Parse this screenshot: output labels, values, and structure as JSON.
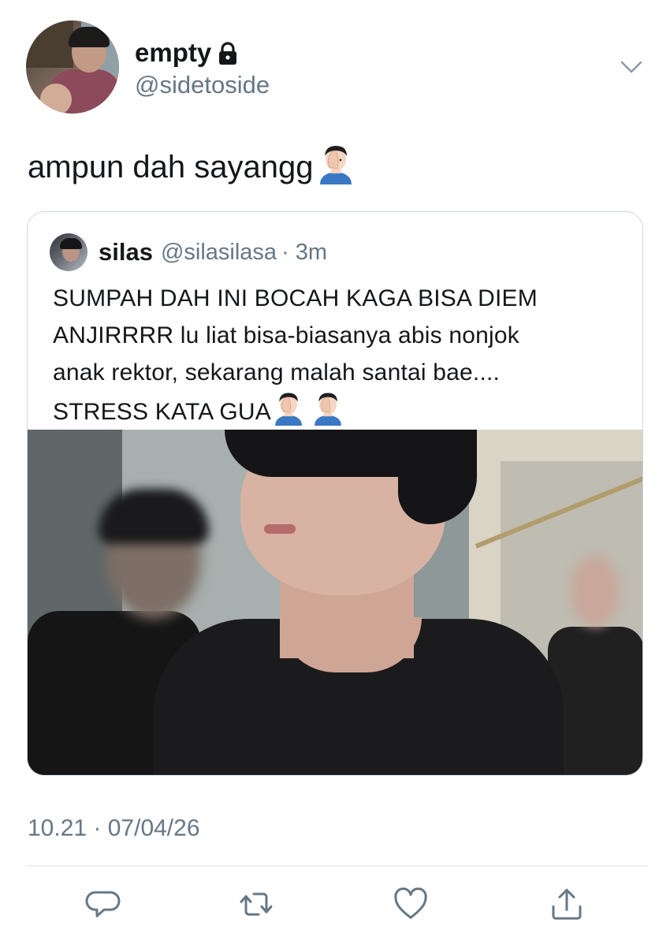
{
  "author": {
    "display_name": "empty",
    "handle": "@sidetoside",
    "avatar_icon": "user-avatar",
    "lock_icon": "lock-icon"
  },
  "tweet": {
    "text": "ampun dah sayangg",
    "emoji": "facepalm-emoji",
    "timestamp": "10.21 · 07/04/26"
  },
  "quoted_tweet": {
    "display_name": "silas",
    "handle": "@silasilasa",
    "time": "· 3m",
    "lines": [
      "SUMPAH DAH INI BOCAH KAGA BISA DIEM",
      "ANJIRRRR lu liat bisa-biasanya abis nonjok",
      "anak rektor, sekarang malah santai bae....",
      "STRESS KATA GUA"
    ],
    "trailing_emojis": [
      "facepalm-emoji",
      "facepalm-emoji"
    ]
  },
  "actions": {
    "reply_icon": "reply-icon",
    "retweet_icon": "retweet-icon",
    "like_icon": "heart-icon",
    "share_icon": "share-icon"
  },
  "colors": {
    "primary_text": "#14171a",
    "secondary_text": "#657786",
    "border": "#ccd6dd",
    "divider": "#e1e8ed"
  }
}
